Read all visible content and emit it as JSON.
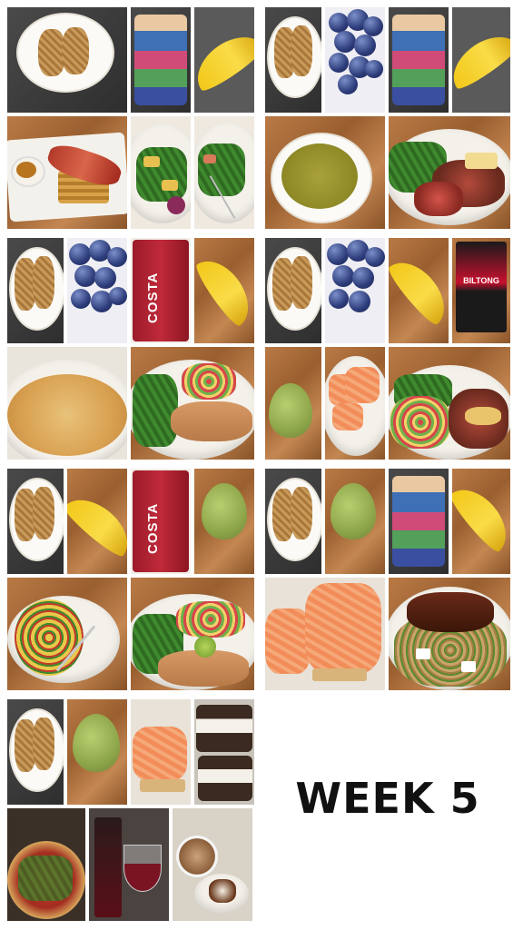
{
  "title": "WEEK 5",
  "colors": {
    "background": "#ffffff",
    "title": "#111111"
  },
  "photos": [
    "porridge-bowl",
    "mug",
    "banana",
    "porridge-bowl",
    "blueberries",
    "mug",
    "banana",
    "waffles-bacon",
    "stir-fry-vegetables",
    "stir-fry-with-fork",
    "pea-soup",
    "steak-green-beans",
    "porridge-bowl",
    "blueberries",
    "costa-coffee-cup",
    "banana",
    "porridge-bowl",
    "blueberries",
    "banana",
    "biltong-packet",
    "omelette",
    "fish-broccoli-salsa",
    "pear",
    "salmon-crackers",
    "steak-salsa-greens",
    "porridge-bowl",
    "banana",
    "costa-coffee-cup",
    "pear",
    "porridge-bowl",
    "pear",
    "mug",
    "banana",
    "frittata-with-fork",
    "fish-broccoli-salsa",
    "smoked-salmon",
    "lamb-couscous",
    "porridge-bowl",
    "pear",
    "smoked-salmon",
    "marshmallow-cakes",
    "pizza-restaurant",
    "red-wine",
    "cappuccino-dessert"
  ],
  "costa_label": "COSTA",
  "biltong_label": "BILTONG"
}
